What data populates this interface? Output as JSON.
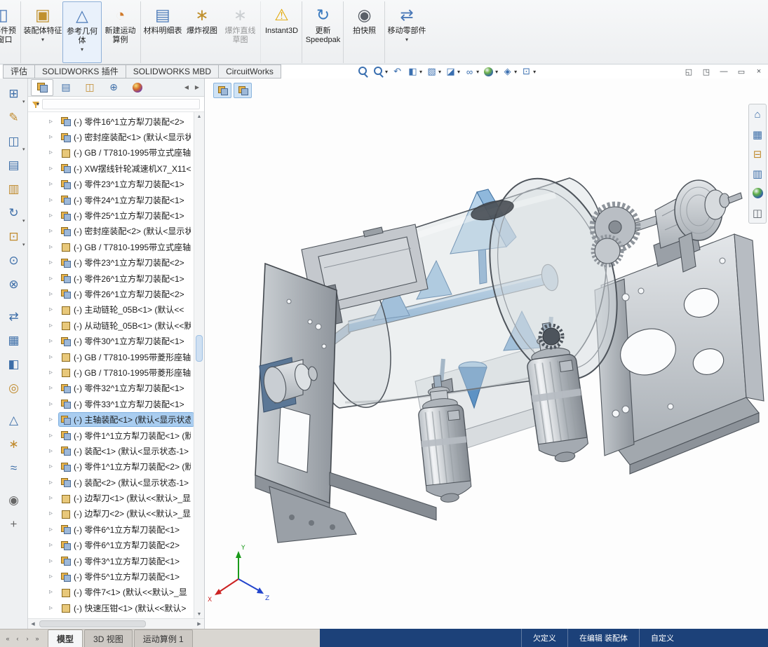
{
  "theme": {
    "status-blue": "#1c4179",
    "selection-blue": "#a9cdf0",
    "steel": "#c7ccd2",
    "steel-dark": "#8d939a",
    "edge-color": "#4e545b",
    "part-blue": "#7fa8d0",
    "amber": "#e8b34b"
  },
  "ribbon": {
    "buttons": [
      {
        "name": "component-preview-window-button",
        "label": "零部件预览窗口",
        "icon": "preview-window-icon",
        "glyph": "◫",
        "clipped": true,
        "sep_after": true
      },
      {
        "name": "assembly-features-button",
        "label": "装配体特征",
        "icon": "assembly-features-icon",
        "glyph": "▣",
        "dropdown": true
      },
      {
        "name": "reference-geometry-button",
        "label": "参考几何体",
        "icon": "reference-geometry-icon",
        "glyph": "△",
        "dropdown": true,
        "boxed": true
      },
      {
        "name": "new-motion-study-button",
        "label": "新建运动算例",
        "icon": "motion-study-icon",
        "glyph": "◔",
        "sep_after": true
      },
      {
        "name": "bill-of-materials-button",
        "label": "材料明细表",
        "icon": "bom-icon",
        "glyph": "▤"
      },
      {
        "name": "exploded-view-button",
        "label": "爆炸视图",
        "icon": "exploded-view-icon",
        "glyph": "∗"
      },
      {
        "name": "explode-line-sketch-button",
        "label": "爆炸直线草图",
        "icon": "explode-lines-icon",
        "glyph": "∗",
        "disabled": true,
        "sep_after": true
      },
      {
        "name": "instant3d-button",
        "label": "Instant3D",
        "icon": "instant3d-icon",
        "glyph": "⚠",
        "sep_after": true
      },
      {
        "name": "update-speedpak-button",
        "label": "更新 Speedpak",
        "icon": "speedpak-icon",
        "glyph": "↻",
        "sep_after": true
      },
      {
        "name": "take-snapshot-button",
        "label": "拍快照",
        "icon": "snapshot-icon",
        "glyph": "◉",
        "sep_after": true
      },
      {
        "name": "move-component-button",
        "label": "移动零部件",
        "icon": "move-component-icon",
        "glyph": "⇄",
        "dropdown": true
      }
    ]
  },
  "context_tabs": {
    "items": [
      {
        "name": "tab-evaluate",
        "label": "评估"
      },
      {
        "name": "tab-solidworks-addins",
        "label": "SOLIDWORKS 插件"
      },
      {
        "name": "tab-solidworks-mbd",
        "label": "SOLIDWORKS MBD"
      },
      {
        "name": "tab-circuitworks",
        "label": "CircuitWorks"
      }
    ]
  },
  "hud": {
    "items": [
      {
        "name": "zoom-fit-icon",
        "kind": "mag"
      },
      {
        "name": "zoom-area-icon",
        "kind": "mag",
        "dropdown": true
      },
      {
        "name": "previous-view-icon",
        "kind": "glyph",
        "glyph": "↶"
      },
      {
        "name": "section-view-icon",
        "kind": "glyph",
        "glyph": "◧",
        "dropdown": true
      },
      {
        "name": "view-orientation-icon",
        "kind": "glyph",
        "glyph": "▧",
        "dropdown": true
      },
      {
        "name": "display-style-icon",
        "kind": "glyph",
        "glyph": "◪",
        "dropdown": true
      },
      {
        "name": "hide-show-items-icon",
        "kind": "glyph",
        "glyph": "∞",
        "dropdown": true
      },
      {
        "name": "edit-appearance-icon",
        "kind": "ball",
        "dropdown": true
      },
      {
        "name": "apply-scene-icon",
        "kind": "glyph",
        "glyph": "◈",
        "dropdown": true
      },
      {
        "name": "view-settings-icon",
        "kind": "glyph",
        "glyph": "⊡",
        "dropdown": true
      }
    ]
  },
  "window_controls": {
    "items": [
      {
        "name": "pane-preview-left-icon",
        "glyph": "◱"
      },
      {
        "name": "pane-preview-right-icon",
        "glyph": "◳"
      },
      {
        "name": "minimize-button",
        "glyph": "―"
      },
      {
        "name": "restore-button",
        "glyph": "▭"
      },
      {
        "name": "close-button",
        "glyph": "×"
      }
    ]
  },
  "left_toolbar": {
    "items": [
      {
        "name": "clipboard-icon",
        "glyph": "⊞",
        "tone": "blue",
        "dropdown": true
      },
      {
        "name": "attachment-icon",
        "glyph": "✎",
        "tone": "amber"
      },
      {
        "name": "window-layout-icon",
        "glyph": "◫",
        "tone": "blue",
        "dropdown": true
      },
      {
        "name": "edit-component-icon",
        "glyph": "▤",
        "tone": "blue"
      },
      {
        "name": "document-icon",
        "glyph": "▥",
        "tone": "amber"
      },
      {
        "name": "rotate-component-icon",
        "glyph": "↻",
        "tone": "blue",
        "dropdown": true
      },
      {
        "name": "insert-component-icon",
        "glyph": "⊡",
        "tone": "amber",
        "dropdown": true
      },
      {
        "name": "mate-icon",
        "glyph": "⊙",
        "tone": "blue"
      },
      {
        "name": "smart-fastener-icon",
        "glyph": "⊗",
        "tone": "blue"
      },
      {
        "name": "move-component-icon",
        "glyph": "⇄",
        "tone": "blue",
        "gap": true
      },
      {
        "name": "linear-pattern-icon",
        "glyph": "▦",
        "tone": "blue"
      },
      {
        "name": "mirror-components-icon",
        "glyph": "◧",
        "tone": "blue"
      },
      {
        "name": "assembly-feature-icon",
        "glyph": "◎",
        "tone": "amber"
      },
      {
        "name": "reference-geometry-icon",
        "glyph": "△",
        "tone": "blue",
        "gap": true
      },
      {
        "name": "exploded-view-icon",
        "glyph": "∗",
        "tone": "amber"
      },
      {
        "name": "motion-icon",
        "glyph": "≈",
        "tone": "blue"
      },
      {
        "name": "snapshot-tool-icon",
        "glyph": "◉",
        "tone": "gray",
        "gap": true
      },
      {
        "name": "grid-system-icon",
        "glyph": "+",
        "tone": "gray"
      }
    ]
  },
  "panel": {
    "tabs": [
      {
        "name": "featuremanager-tab",
        "kind": "asm",
        "active": true
      },
      {
        "name": "propertymanager-tab",
        "kind": "glyph",
        "glyph": "▤",
        "tone": "blue"
      },
      {
        "name": "configurationmanager-tab",
        "kind": "glyph",
        "glyph": "◫",
        "tone": "amber"
      },
      {
        "name": "dimxpertmanager-tab",
        "kind": "glyph",
        "glyph": "⊕",
        "tone": "blue"
      },
      {
        "name": "displaymanager-tab",
        "kind": "ball"
      }
    ],
    "nav_left": "◀",
    "nav_right": "▶",
    "filter_caret": "▾"
  },
  "tree": {
    "items": [
      {
        "label": "(-) 零件16^1立方犁刀装配<2>",
        "type": "assembly"
      },
      {
        "label": "(-) 密封座装配<1> (默认<显示状",
        "type": "assembly"
      },
      {
        "label": "(-) GB / T7810-1995带立式座轴",
        "type": "part"
      },
      {
        "label": "(-) XW摆线针轮减速机X7_X11<",
        "type": "assembly"
      },
      {
        "label": "(-) 零件23^1立方犁刀装配<1>",
        "type": "assembly"
      },
      {
        "label": "(-) 零件24^1立方犁刀装配<1>",
        "type": "assembly"
      },
      {
        "label": "(-) 零件25^1立方犁刀装配<1>",
        "type": "assembly"
      },
      {
        "label": "(-) 密封座装配<2> (默认<显示状",
        "type": "assembly"
      },
      {
        "label": "(-) GB / T7810-1995带立式座轴",
        "type": "part"
      },
      {
        "label": "(-) 零件23^1立方犁刀装配<2>",
        "type": "assembly"
      },
      {
        "label": "(-) 零件26^1立方犁刀装配<1>",
        "type": "assembly"
      },
      {
        "label": "(-) 零件26^1立方犁刀装配<2>",
        "type": "assembly"
      },
      {
        "label": "(-) 主动链轮_05B<1> (默认<<",
        "type": "part"
      },
      {
        "label": "(-) 从动链轮_05B<1> (默认<<默",
        "type": "part"
      },
      {
        "label": "(-) 零件30^1立方犁刀装配<1>",
        "type": "assembly"
      },
      {
        "label": "(-) GB / T7810-1995带菱形座轴",
        "type": "part"
      },
      {
        "label": "(-) GB / T7810-1995带菱形座轴",
        "type": "part"
      },
      {
        "label": "(-) 零件32^1立方犁刀装配<1>",
        "type": "assembly"
      },
      {
        "label": "(-) 零件33^1立方犁刀装配<1>",
        "type": "assembly"
      },
      {
        "label": "(-) 主轴装配<1> (默认<显示状态",
        "type": "assembly",
        "selected": true
      },
      {
        "label": "(-) 零件1^1立方犁刀装配<1> (默",
        "type": "assembly"
      },
      {
        "label": "(-) 装配<1> (默认<显示状态-1>",
        "type": "assembly"
      },
      {
        "label": "(-) 零件1^1立方犁刀装配<2> (默",
        "type": "assembly"
      },
      {
        "label": "(-) 装配<2> (默认<显示状态-1>",
        "type": "assembly"
      },
      {
        "label": "(-) 边犁刀<1> (默认<<默认>_显",
        "type": "part"
      },
      {
        "label": "(-) 边犁刀<2> (默认<<默认>_显",
        "type": "part"
      },
      {
        "label": "(-) 零件6^1立方犁刀装配<1>",
        "type": "assembly"
      },
      {
        "label": "(-) 零件6^1立方犁刀装配<2>",
        "type": "assembly"
      },
      {
        "label": "(-) 零件3^1立方犁刀装配<1>",
        "type": "assembly"
      },
      {
        "label": "(-) 零件5^1立方犁刀装配<1>",
        "type": "assembly"
      },
      {
        "label": "(-) 零件7<1> (默认<<默认>_显",
        "type": "part"
      },
      {
        "label": "(-) 快速压钳<1> (默认<<默认>",
        "type": "part"
      }
    ]
  },
  "viewport": {
    "triad": {
      "x": "X",
      "y": "Y",
      "z": "Z"
    },
    "breadcrumbs": [
      {
        "name": "breadcrumb-assembly-icon-1"
      },
      {
        "name": "breadcrumb-assembly-icon-2"
      }
    ]
  },
  "taskpane": {
    "items": [
      {
        "name": "home-icon",
        "kind": "glyph",
        "glyph": "⌂",
        "tone": "blue"
      },
      {
        "name": "resources-icon",
        "kind": "glyph",
        "glyph": "▦",
        "tone": "blue"
      },
      {
        "name": "design-library-icon",
        "kind": "glyph",
        "glyph": "⊟",
        "tone": "amber"
      },
      {
        "name": "view-palette-icon",
        "kind": "glyph",
        "glyph": "▥",
        "tone": "blue"
      },
      {
        "name": "appearances-icon",
        "kind": "ball"
      },
      {
        "name": "custom-properties-icon",
        "kind": "glyph",
        "glyph": "◫",
        "tone": "gray"
      }
    ]
  },
  "bottom": {
    "nav": [
      "«",
      "‹",
      "›",
      "»"
    ],
    "tabs": [
      {
        "name": "tab-model",
        "label": "模型",
        "active": true
      },
      {
        "name": "tab-3d-views",
        "label": "3D 视图"
      },
      {
        "name": "tab-motion-study-1",
        "label": "运动算例 1"
      }
    ]
  },
  "status": {
    "items": [
      {
        "name": "status-underdefined",
        "label": "欠定义"
      },
      {
        "name": "status-editing-assembly",
        "label": "在编辑 装配体"
      },
      {
        "name": "status-custom",
        "label": "自定义"
      }
    ]
  }
}
